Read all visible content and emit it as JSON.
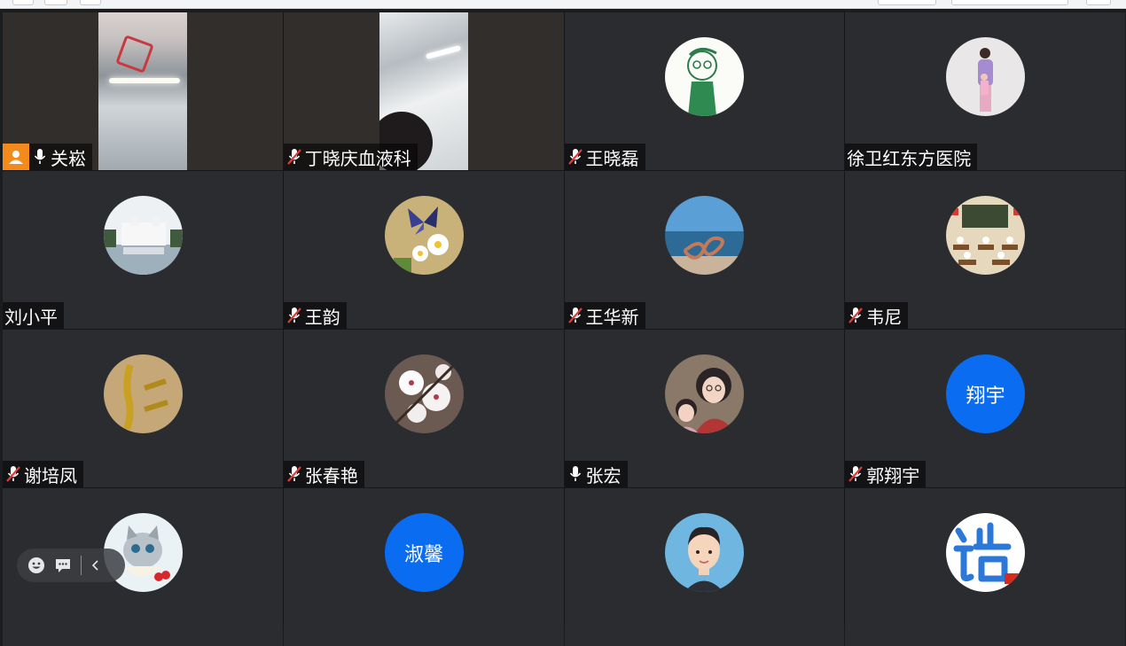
{
  "participants": [
    {
      "name": "关崧",
      "mic": "on",
      "host": true,
      "view": "video1",
      "active": true
    },
    {
      "name": "丁晓庆血液科",
      "mic": "muted",
      "view": "video2"
    },
    {
      "name": "王晓磊",
      "mic": "muted",
      "view": "avatar-sketch"
    },
    {
      "name": "徐卫红东方医院",
      "mic": "none",
      "view": "avatar-photo-pink"
    },
    {
      "name": "刘小平",
      "mic": "none",
      "view": "avatar-building"
    },
    {
      "name": "王韵",
      "mic": "muted",
      "view": "avatar-butterfly"
    },
    {
      "name": "王华新",
      "mic": "muted",
      "view": "avatar-sea"
    },
    {
      "name": "韦尼",
      "mic": "muted",
      "view": "avatar-classroom"
    },
    {
      "name": "谢培凤",
      "mic": "muted",
      "view": "avatar-calligraphy"
    },
    {
      "name": "张春艳",
      "mic": "muted",
      "view": "avatar-flowers"
    },
    {
      "name": "张宏",
      "mic": "on",
      "view": "avatar-girl"
    },
    {
      "name": "郭翔宇",
      "mic": "muted",
      "view": "text-avatar",
      "avatar_text": "翔宇"
    },
    {
      "name": "",
      "mic": "none",
      "view": "avatar-cat"
    },
    {
      "name": "",
      "mic": "none",
      "view": "text-avatar",
      "avatar_text": "淑馨"
    },
    {
      "name": "",
      "mic": "none",
      "view": "avatar-cartoon-man"
    },
    {
      "name": "",
      "mic": "none",
      "view": "avatar-hao"
    }
  ],
  "colors": {
    "tile_bg": "#2a2c30",
    "active_border": "#27c06b",
    "host_badge": "#f28b1c",
    "text_avatar_bg": "#0a6cf0",
    "mute_red": "#e23b3b"
  },
  "floating_toolbar": {
    "icons": [
      "emoji-icon",
      "chat-icon",
      "collapse-icon"
    ]
  }
}
